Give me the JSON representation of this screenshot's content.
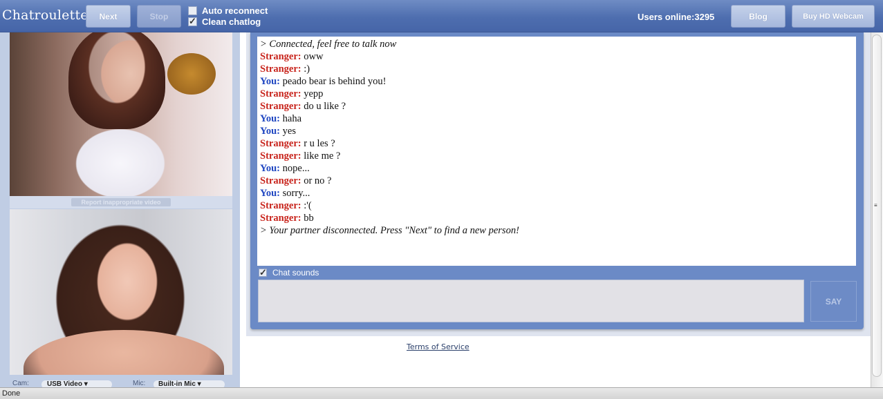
{
  "header": {
    "logo": "Chatroulette",
    "next_label": "Next",
    "stop_label": "Stop",
    "auto_reconnect_label": "Auto reconnect",
    "auto_reconnect_checked": false,
    "clean_chatlog_label": "Clean chatlog",
    "clean_chatlog_checked": true,
    "users_online": "Users online:3295",
    "blog_label": "Blog",
    "buy_webcam_label": "Buy HD Webcam"
  },
  "video": {
    "report_label": "Report inappropriate video"
  },
  "devices": {
    "cam_label": "Cam:",
    "cam_value": "USB Video",
    "mic_label": "Mic:",
    "mic_value": "Built-in Mic"
  },
  "chat": {
    "lines": [
      {
        "type": "sys",
        "text": "> Connected, feel free to talk now"
      },
      {
        "type": "stranger",
        "speaker": "Stranger:",
        "text": "oww"
      },
      {
        "type": "stranger",
        "speaker": "Stranger:",
        "text": ":)"
      },
      {
        "type": "you",
        "speaker": "You:",
        "text": "peado bear is behind you!"
      },
      {
        "type": "stranger",
        "speaker": "Stranger:",
        "text": "yepp"
      },
      {
        "type": "stranger",
        "speaker": "Stranger:",
        "text": "do u like ?"
      },
      {
        "type": "you",
        "speaker": "You:",
        "text": "haha"
      },
      {
        "type": "you",
        "speaker": "You:",
        "text": "yes"
      },
      {
        "type": "stranger",
        "speaker": "Stranger:",
        "text": "r u les ?"
      },
      {
        "type": "stranger",
        "speaker": "Stranger:",
        "text": "like me ?"
      },
      {
        "type": "you",
        "speaker": "You:",
        "text": "nope..."
      },
      {
        "type": "stranger",
        "speaker": "Stranger:",
        "text": "or no ?"
      },
      {
        "type": "you",
        "speaker": "You:",
        "text": "sorry..."
      },
      {
        "type": "stranger",
        "speaker": "Stranger:",
        "text": ":'("
      },
      {
        "type": "stranger",
        "speaker": "Stranger:",
        "text": "bb"
      },
      {
        "type": "sys",
        "text": "> Your partner disconnected. Press \"Next\" to find a new person!"
      }
    ],
    "sounds_label": "Chat sounds",
    "sounds_checked": true,
    "say_label": "SAY"
  },
  "footer": {
    "tos_label": "Terms of Service"
  },
  "status_bar": {
    "text": "Done"
  }
}
